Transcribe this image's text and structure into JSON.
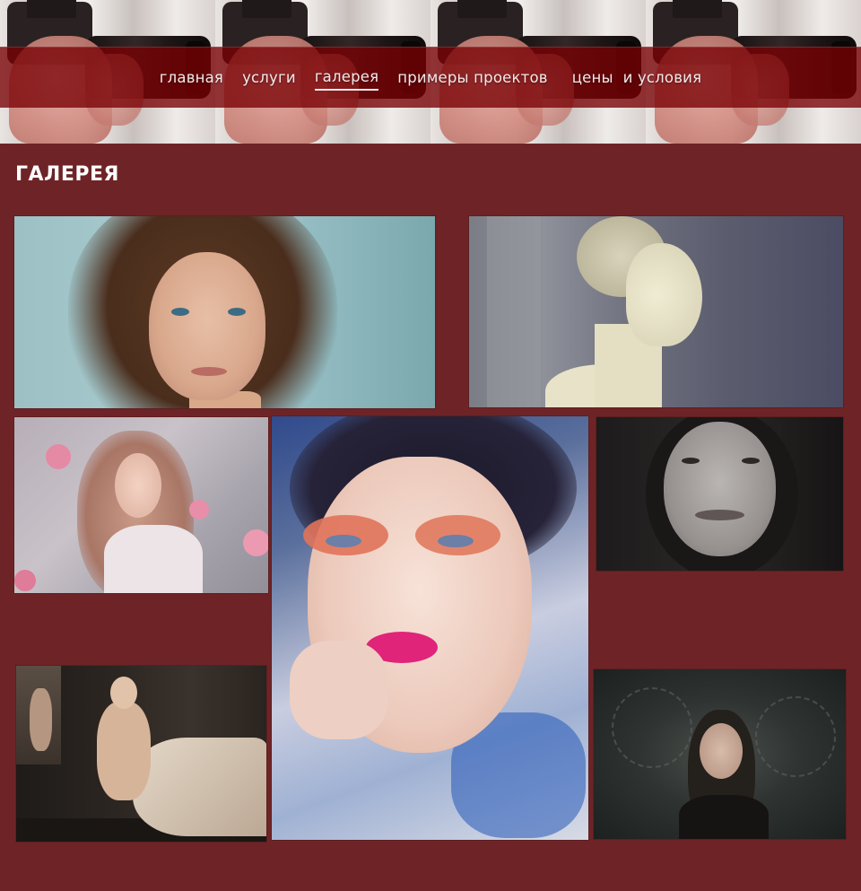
{
  "nav": {
    "items": [
      {
        "label": "главная"
      },
      {
        "label": "услуги"
      },
      {
        "label": "галерея"
      },
      {
        "label": "примеры проектов"
      },
      {
        "label": "цены  и условия"
      }
    ],
    "active_index": 2
  },
  "page": {
    "title": "ГАЛЕРЕЯ"
  },
  "colors": {
    "background": "#6e2426",
    "nav_band": "#780004",
    "text": "#ffffff"
  },
  "gallery": {
    "photos": [
      {
        "name": "portrait-freckles"
      },
      {
        "name": "portrait-profile-updo"
      },
      {
        "name": "portrait-roses"
      },
      {
        "name": "portrait-bold-makeup"
      },
      {
        "name": "portrait-bw-smile"
      },
      {
        "name": "portrait-seated-dancer"
      },
      {
        "name": "portrait-dark-foliage"
      }
    ]
  }
}
